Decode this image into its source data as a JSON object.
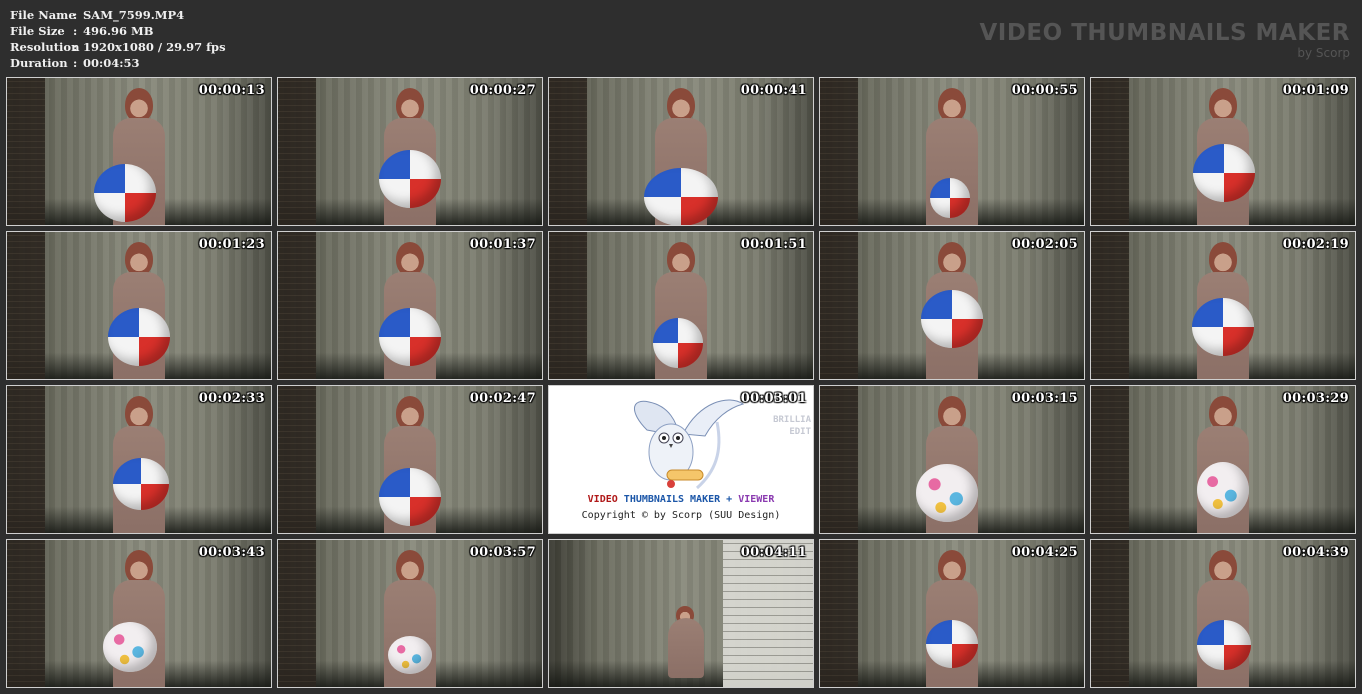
{
  "file_info": {
    "rows": [
      {
        "key": "File Name",
        "sep": ":",
        "value": "SAM_7599.MP4"
      },
      {
        "key": "File Size",
        "sep": ":",
        "value": "496.96 MB"
      },
      {
        "key": "Resolution",
        "sep": ":",
        "value": "1920x1080 / 29.97 fps"
      },
      {
        "key": "Duration",
        "sep": ":",
        "value": "00:04:53"
      }
    ]
  },
  "brand": {
    "title": "VIDEO THUMBNAILS MAKER",
    "subtitle": "by Scorp"
  },
  "thumbnails": [
    {
      "time": "00:00:13"
    },
    {
      "time": "00:00:27"
    },
    {
      "time": "00:00:41"
    },
    {
      "time": "00:00:55"
    },
    {
      "time": "00:01:09"
    },
    {
      "time": "00:01:23"
    },
    {
      "time": "00:01:37"
    },
    {
      "time": "00:01:51"
    },
    {
      "time": "00:02:05"
    },
    {
      "time": "00:02:19"
    },
    {
      "time": "00:02:33"
    },
    {
      "time": "00:02:47"
    },
    {
      "time": "00:03:01"
    },
    {
      "time": "00:03:15"
    },
    {
      "time": "00:03:29"
    },
    {
      "time": "00:03:43"
    },
    {
      "time": "00:03:57"
    },
    {
      "time": "00:04:11"
    },
    {
      "time": "00:04:25"
    },
    {
      "time": "00:04:39"
    }
  ],
  "logo_overlay": {
    "brand_w1": "VIDEO",
    "brand_w2": "THUMBNAILS MAKER",
    "brand_plus": "+",
    "brand_w3": "VIEWER",
    "copyright": "Copyright © by Scorp (SUU Design)",
    "side_1": "BRILLIA",
    "side_2": "EDIT"
  }
}
